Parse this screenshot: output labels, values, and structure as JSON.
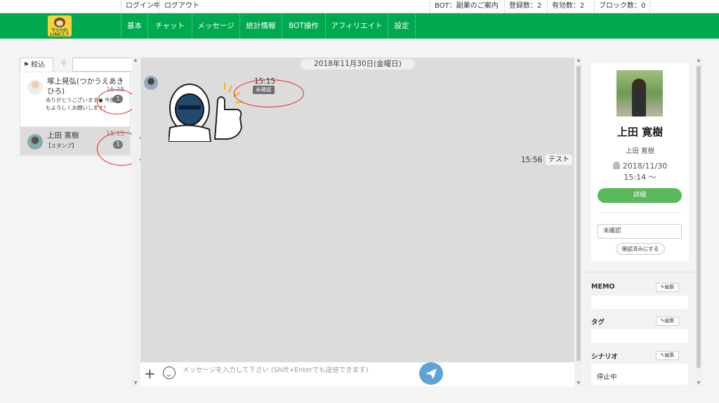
{
  "topbar": {
    "login_status": "ログイン中",
    "logout": "ログアウト",
    "bot_name": "BOT：副業のご案内",
    "registered": "登録数：2",
    "valid": "有効数：2",
    "blocked": "ブロック数：0"
  },
  "logo": {
    "text": "サルわれ LINEスクール"
  },
  "nav": [
    {
      "label": "基本"
    },
    {
      "label": "チャット"
    },
    {
      "label": "メッセージ"
    },
    {
      "label": "統計情報"
    },
    {
      "label": "BOT操作"
    },
    {
      "label": "アフィリエイト"
    },
    {
      "label": "設定"
    }
  ],
  "left": {
    "filter_label": "絞込",
    "search_icon": "search-icon",
    "friends": [
      {
        "name": "塚上晃弘(つかうえあきひろ)",
        "time": "16:28",
        "unread": "1",
        "preview": "ありがとうございます● 今後ともよろしくお願いします！"
      },
      {
        "name": "上田 寛樹",
        "time": "15:15",
        "unread": "1",
        "preview": "【スタンプ】"
      }
    ]
  },
  "chat": {
    "date": "2018年11月30日(金曜日)",
    "stamp_time": "15:15",
    "unread_label": "未確認",
    "outgoing_time": "15:56",
    "outgoing_text": "テスト",
    "composer_placeholder": "メッセージを入力して下さい (Shift+Enterでも送信できます)"
  },
  "profile": {
    "display_name": "上田 寛樹",
    "sub_name": "上田 寛樹",
    "date": "2018/11/30",
    "time": "15:14 ～",
    "detail_button": "詳細",
    "status_value": "未確認",
    "confirm_button": "確認済みにする"
  },
  "sections": {
    "memo": "MEMO",
    "tag": "タグ",
    "scenario": "シナリオ",
    "edit_label": "編集",
    "scenario_value": "停止中"
  },
  "colors": {
    "nav_green": "#00a850",
    "send_blue": "#5ea3d8",
    "detail_green": "#5cb85c",
    "annotation_red": "#e0292c"
  }
}
